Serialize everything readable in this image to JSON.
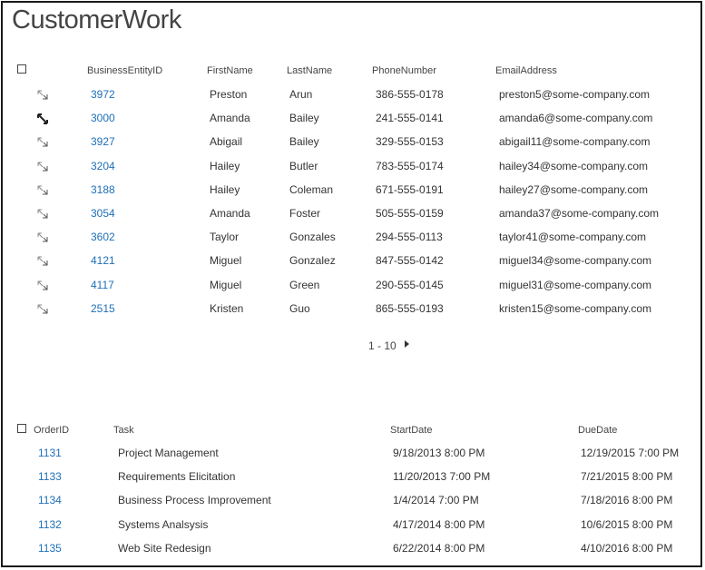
{
  "page": {
    "title": "CustomerWork"
  },
  "customers": {
    "columns": [
      "BusinessEntityID",
      "FirstName",
      "LastName",
      "PhoneNumber",
      "EmailAddress"
    ],
    "rows": [
      [
        "3972",
        "Preston",
        "Arun",
        "386-555-0178",
        "preston5@some-company.com"
      ],
      [
        "3000",
        "Amanda",
        "Bailey",
        "241-555-0141",
        "amanda6@some-company.com"
      ],
      [
        "3927",
        "Abigail",
        "Bailey",
        "329-555-0153",
        "abigail11@some-company.com"
      ],
      [
        "3204",
        "Hailey",
        "Butler",
        "783-555-0174",
        "hailey34@some-company.com"
      ],
      [
        "3188",
        "Hailey",
        "Coleman",
        "671-555-0191",
        "hailey27@some-company.com"
      ],
      [
        "3054",
        "Amanda",
        "Foster",
        "505-555-0159",
        "amanda37@some-company.com"
      ],
      [
        "3602",
        "Taylor",
        "Gonzales",
        "294-555-0113",
        "taylor41@some-company.com"
      ],
      [
        "4121",
        "Miguel",
        "Gonzalez",
        "847-555-0142",
        "miguel34@some-company.com"
      ],
      [
        "4117",
        "Miguel",
        "Green",
        "290-555-0145",
        "miguel31@some-company.com"
      ],
      [
        "2515",
        "Kristen",
        "Guo",
        "865-555-0193",
        "kristen15@some-company.com"
      ]
    ],
    "pager": {
      "range": "1 - 10"
    }
  },
  "orders": {
    "columns": [
      "OrderID",
      "Task",
      "StartDate",
      "DueDate"
    ],
    "rows": [
      [
        "1131",
        "Project Management",
        "9/18/2013 8:00 PM",
        "12/19/2015 7:00 PM"
      ],
      [
        "1133",
        "Requirements Elicitation",
        "11/20/2013 7:00 PM",
        "7/21/2015 8:00 PM"
      ],
      [
        "1134",
        "Business Process Improvement",
        "1/4/2014 7:00 PM",
        "7/18/2016 8:00 PM"
      ],
      [
        "1132",
        "Systems Analsysis",
        "4/17/2014 8:00 PM",
        "10/6/2015 8:00 PM"
      ],
      [
        "1135",
        "Web Site Redesign",
        "6/22/2014 8:00 PM",
        "4/10/2016 8:00 PM"
      ]
    ]
  },
  "icons": {
    "row_expand": "expand-arrow-icon",
    "pager_next": "next-page-icon"
  }
}
